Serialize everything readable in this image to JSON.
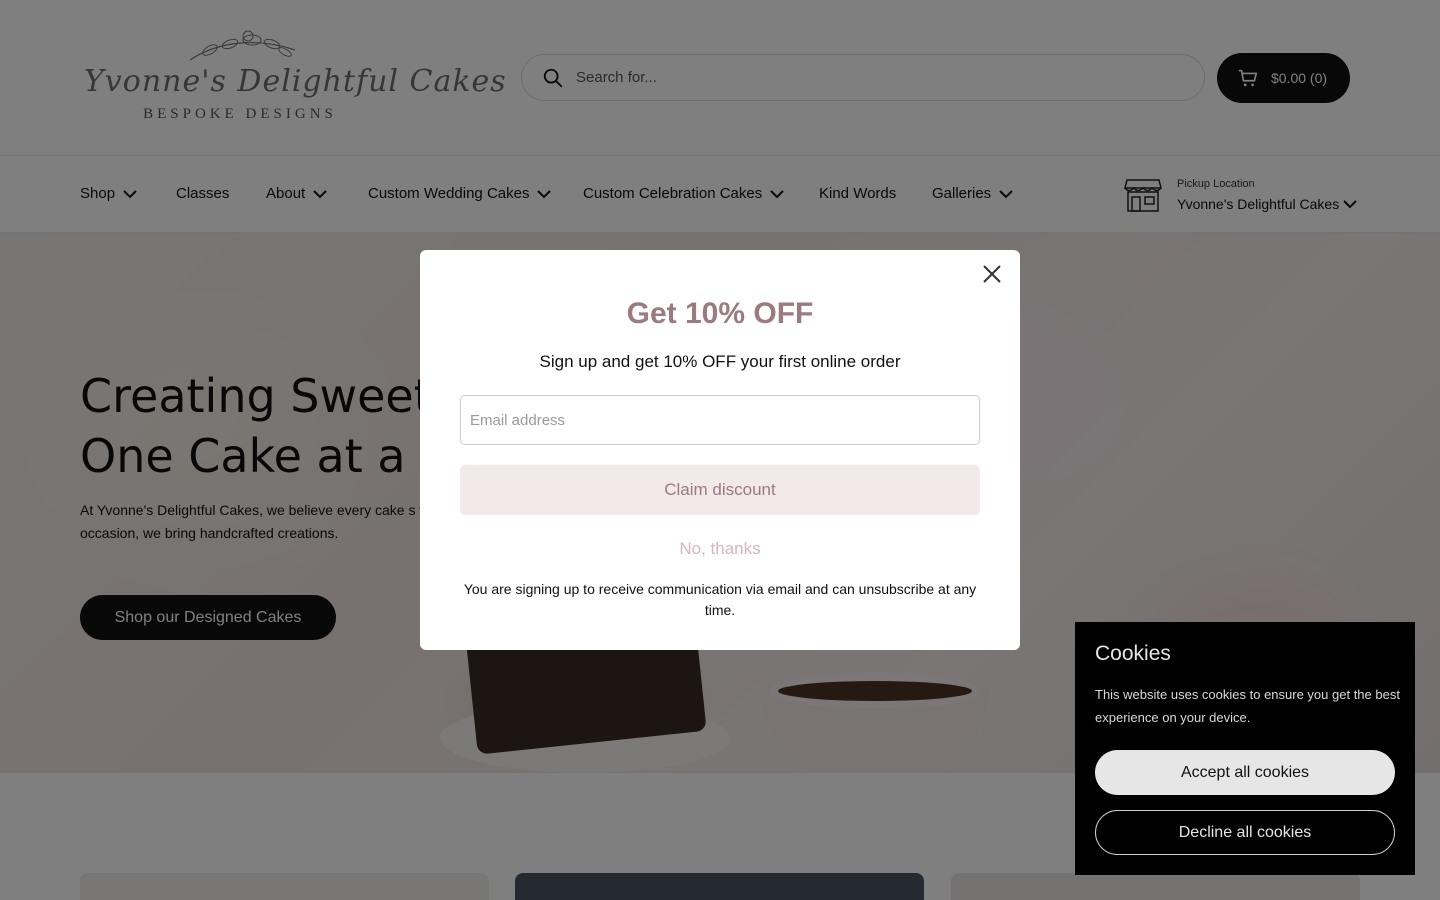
{
  "header": {
    "logo_script": "Yvonne's Delightful Cakes",
    "logo_sub": "BESPOKE DESIGNS",
    "search_placeholder": "Search for...",
    "cart_label": "$0.00 (0)"
  },
  "nav": {
    "items": [
      {
        "label": "Shop",
        "has_dropdown": true
      },
      {
        "label": "Classes",
        "has_dropdown": false
      },
      {
        "label": "About",
        "has_dropdown": true
      },
      {
        "label": "Custom Wedding Cakes",
        "has_dropdown": true
      },
      {
        "label": "Custom Celebration Cakes",
        "has_dropdown": true
      },
      {
        "label": "Kind Words",
        "has_dropdown": false
      },
      {
        "label": "Galleries",
        "has_dropdown": true
      }
    ],
    "pickup": {
      "label": "Pickup Location",
      "value": "Yvonne's Delightful Cakes"
    }
  },
  "hero": {
    "title_line1": "Creating Sweet",
    "title_line2": "One Cake at a T",
    "text": "At Yvonne's Delightful Cakes, we believe every cake s wedding, birthday, or any special occasion, we bring handcrafted creations.",
    "button_label": "Shop our Designed Cakes"
  },
  "modal": {
    "title": "Get 10% OFF",
    "subtitle": "Sign up and get 10% OFF your first online order",
    "email_placeholder": "Email address",
    "claim_label": "Claim discount",
    "decline_label": "No, thanks",
    "legal": "You are signing up to receive communication via email and can unsubscribe at any time."
  },
  "cookie": {
    "title": "Cookies",
    "text": "This website uses cookies to ensure you get the best experience on your device.",
    "accept_label": "Accept all cookies",
    "decline_label": "Decline all cookies"
  },
  "colors": {
    "accent": "#9b7a80",
    "accent_light": "#f2e9ea",
    "dark": "#111111"
  }
}
